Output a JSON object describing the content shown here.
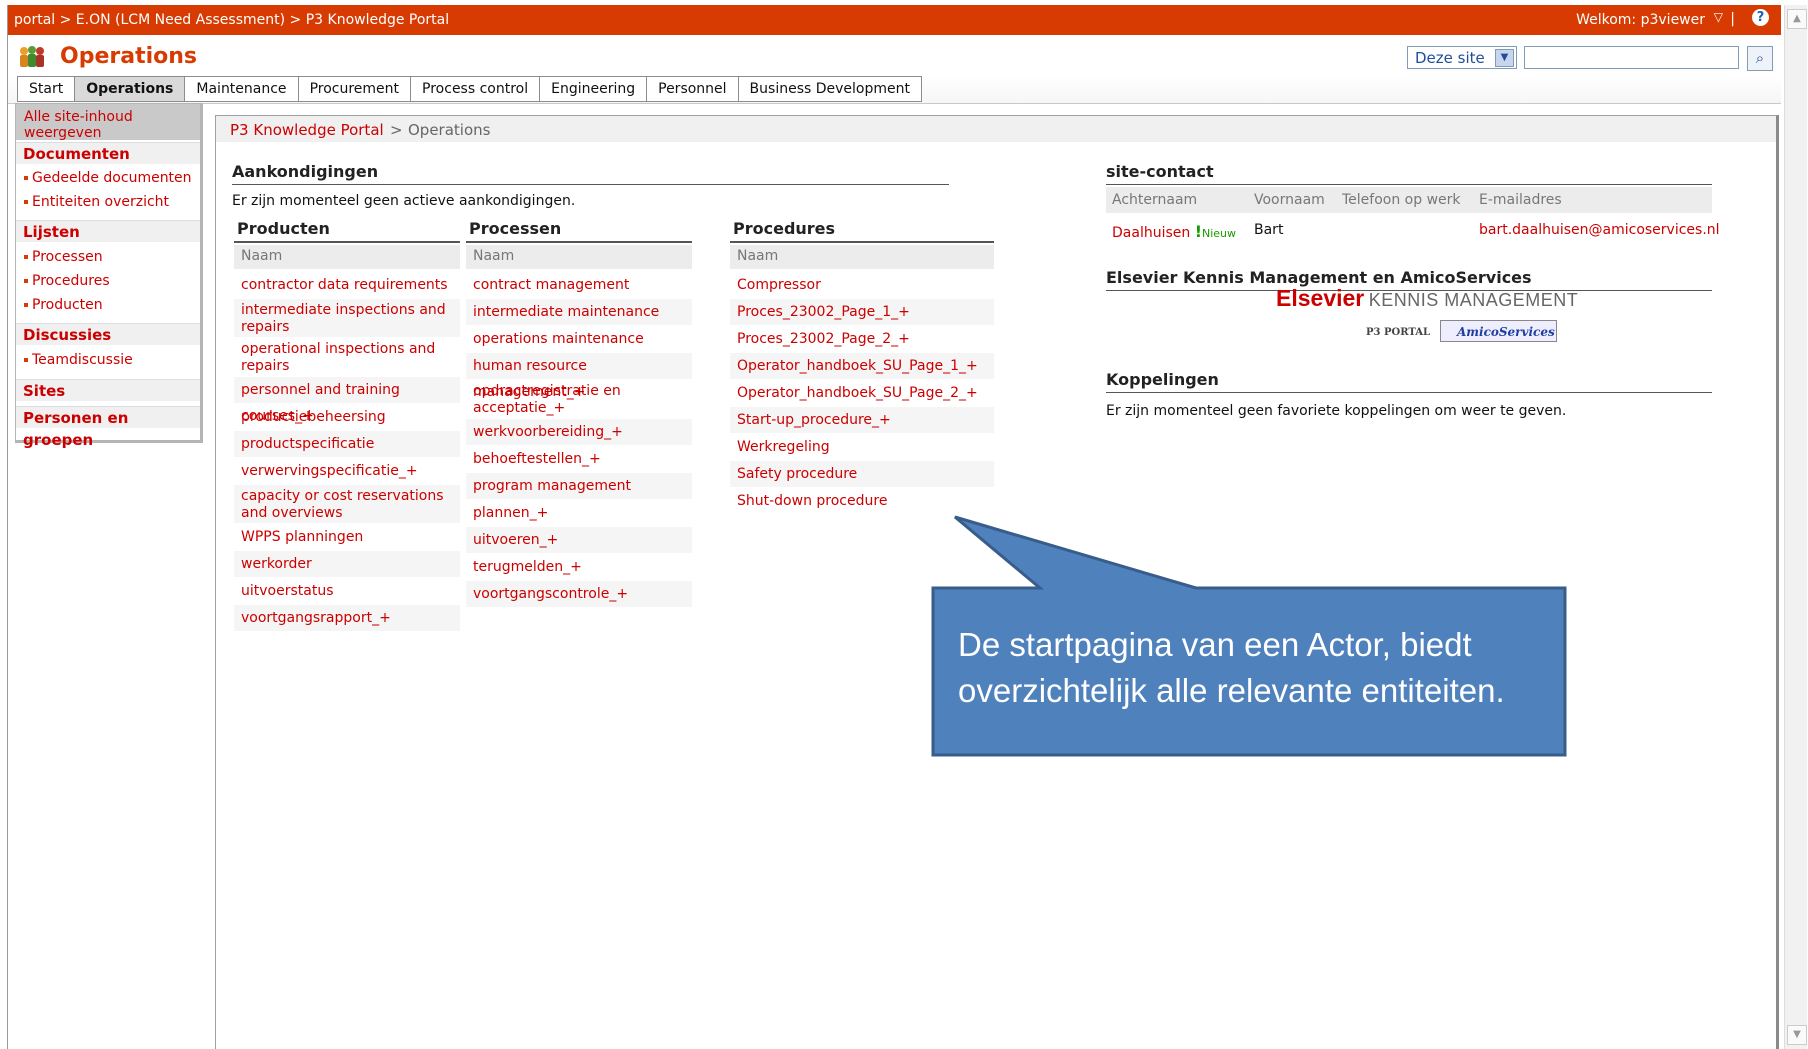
{
  "topbar": {
    "breadcrumb": "portal > E.ON (LCM Need Assessment) > P3 Knowledge Portal",
    "welcome": "Welkom: p3viewer",
    "separator": "|"
  },
  "site": {
    "title": "Operations",
    "scope_option": "Deze site",
    "search_value": ""
  },
  "tabs": [
    "Start",
    "Operations",
    "Maintenance",
    "Procurement",
    "Process control",
    "Engineering",
    "Personnel",
    "Business Development"
  ],
  "active_tab": "Operations",
  "leftnav": {
    "view_all": "Alle site-inhoud weergeven",
    "documenten": "Documenten",
    "gedeelde": "Gedeelde documenten",
    "entiteiten": "Entiteiten overzicht",
    "lijsten": "Lijsten",
    "processen": "Processen",
    "procedures": "Procedures",
    "producten": "Producten",
    "discussies": "Discussies",
    "teamdiscussie": "Teamdiscussie",
    "sites": "Sites",
    "personen": "Personen en groepen"
  },
  "main": {
    "crumb_root": "P3 Knowledge Portal",
    "crumb_sep": ">",
    "crumb_current": "Operations",
    "announcements_title": "Aankondigingen",
    "announcements_empty": "Er zijn momenteel geen actieve aankondigingen.",
    "col_header": "Naam",
    "producten_title": "Producten",
    "processen_title": "Processen",
    "procedures_title": "Procedures",
    "producten": [
      "contractor data requirements list",
      "intermediate inspections and repairs",
      "operational inspections and repairs",
      "personnel and training courses_+",
      "productiebeheersing",
      "productspecificatie",
      "verwervingspecificatie_+",
      "capacity or cost reservations and overviews",
      "WPPS planningen",
      "werkorder",
      "uitvoerstatus",
      "voortgangsrapport_+"
    ],
    "processen": [
      "contract management",
      "intermediate maintenance",
      "operations maintenance",
      "human resource management_+",
      "opdractregistratie en acceptatie_+",
      "werkvoorbereiding_+",
      "behoeftestellen_+",
      "program management",
      "plannen_+",
      "uitvoeren_+",
      "terugmelden_+",
      "voortgangscontrole_+"
    ],
    "procedures": [
      "Compressor",
      "Proces_23002_Page_1_+",
      "Proces_23002_Page_2_+",
      "Operator_handboek_SU_Page_1_+",
      "Operator_handboek_SU_Page_2_+",
      "Start-up_procedure_+",
      "Werkregeling",
      "Safety procedure",
      "Shut-down procedure"
    ]
  },
  "contact": {
    "title": "site-contact",
    "headers": [
      "Achternaam",
      "Voornaam",
      "Telefoon op werk",
      "E-mailadres"
    ],
    "lastname": "Daalhuisen",
    "new_badge": "Nieuw",
    "firstname": "Bart",
    "email": "bart.daalhuisen@amicoservices.nl"
  },
  "logo_section": {
    "title": "Elsevier Kennis Management en AmicoServices",
    "elsevier": "Elsevier",
    "kennis": "KENNIS MANAGEMENT",
    "p3portal": "P3 PORTAL",
    "amico": "AmicoServices"
  },
  "links": {
    "title": "Koppelingen",
    "empty": "Er zijn momenteel geen favoriete koppelingen om weer te geven."
  },
  "callout": {
    "line1": "De startpagina van een Actor, biedt",
    "line2": "overzichtelijk alle relevante entiteiten."
  },
  "colors": {
    "accent": "#d83b01",
    "link": "#cc0000",
    "callout_fill": "#4f81bd",
    "callout_border": "#385d8a"
  }
}
